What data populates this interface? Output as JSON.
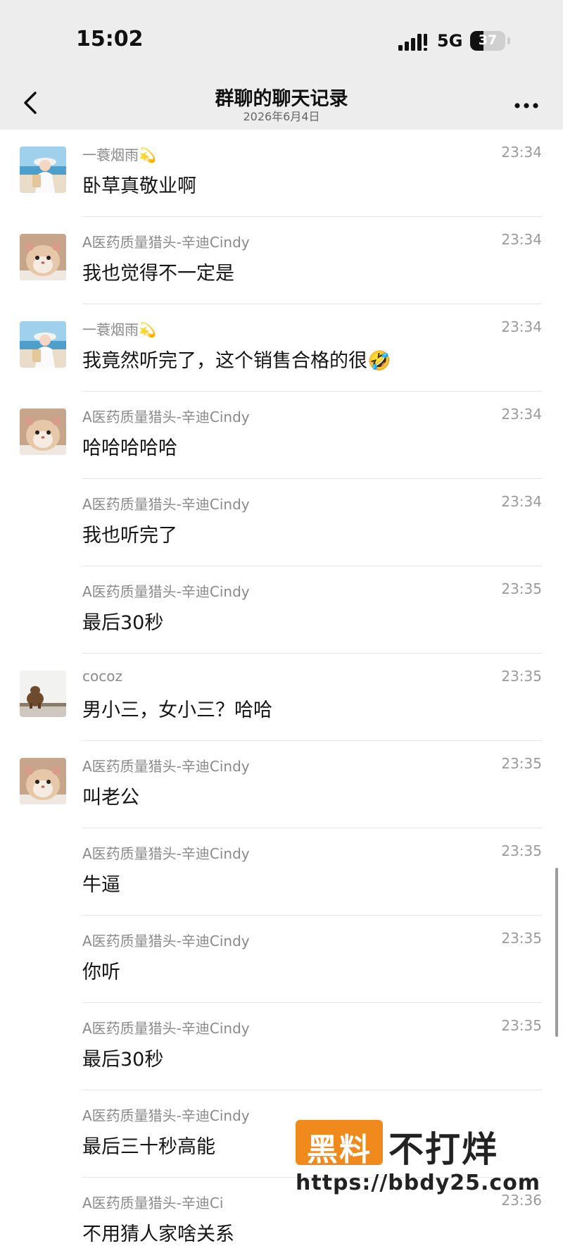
{
  "status_bar": {
    "time": "15:02",
    "network": "5G",
    "battery": "37",
    "battery_level": 0.37
  },
  "header": {
    "title": "群聊的聊天记录",
    "date": "2026年6月4日",
    "back_icon": "chevron-left-icon",
    "more_icon": "more-horizontal-icon"
  },
  "messages": [
    {
      "avatar": "beach-portrait-avatar",
      "name": "一蓑烟雨💫",
      "text": "卧草真敬业啊",
      "time": "23:34"
    },
    {
      "avatar": "hamster-avatar",
      "name": "A医药质量猎头-辛迪Cindy",
      "text": "我也觉得不一定是",
      "time": "23:34"
    },
    {
      "avatar": "beach-portrait-avatar",
      "name": "一蓑烟雨💫",
      "text": "我竟然听完了，这个销售合格的很🤣",
      "time": "23:34"
    },
    {
      "avatar": "hamster-avatar",
      "name": "A医药质量猎头-辛迪Cindy",
      "text": "哈哈哈哈哈",
      "time": "23:34"
    },
    {
      "avatar": "",
      "name": "A医药质量猎头-辛迪Cindy",
      "text": "我也听完了",
      "time": "23:34"
    },
    {
      "avatar": "",
      "name": "A医药质量猎头-辛迪Cindy",
      "text": "最后30秒",
      "time": "23:35"
    },
    {
      "avatar": "capybara-avatar",
      "name": "cocoz",
      "text": "男小三，女小三？哈哈",
      "time": "23:35"
    },
    {
      "avatar": "hamster-avatar",
      "name": "A医药质量猎头-辛迪Cindy",
      "text": "叫老公",
      "time": "23:35"
    },
    {
      "avatar": "",
      "name": "A医药质量猎头-辛迪Cindy",
      "text": "牛逼",
      "time": "23:35"
    },
    {
      "avatar": "",
      "name": "A医药质量猎头-辛迪Cindy",
      "text": "你听",
      "time": "23:35"
    },
    {
      "avatar": "",
      "name": "A医药质量猎头-辛迪Cindy",
      "text": "最后30秒",
      "time": "23:35"
    },
    {
      "avatar": "",
      "name": "A医药质量猎头-辛迪Cindy",
      "text": "最后三十秒高能",
      "time": ""
    },
    {
      "avatar": "",
      "name": "A医药质量猎头-辛迪Ci",
      "text": "不用猜人家啥关系",
      "time": "23:36"
    }
  ],
  "watermark": {
    "badge": "黑料",
    "brand": "不打烊",
    "url": "https://bbdy25.com"
  },
  "colors": {
    "bar_background": "#ededed",
    "watermark_orange": "#f08a1d"
  }
}
